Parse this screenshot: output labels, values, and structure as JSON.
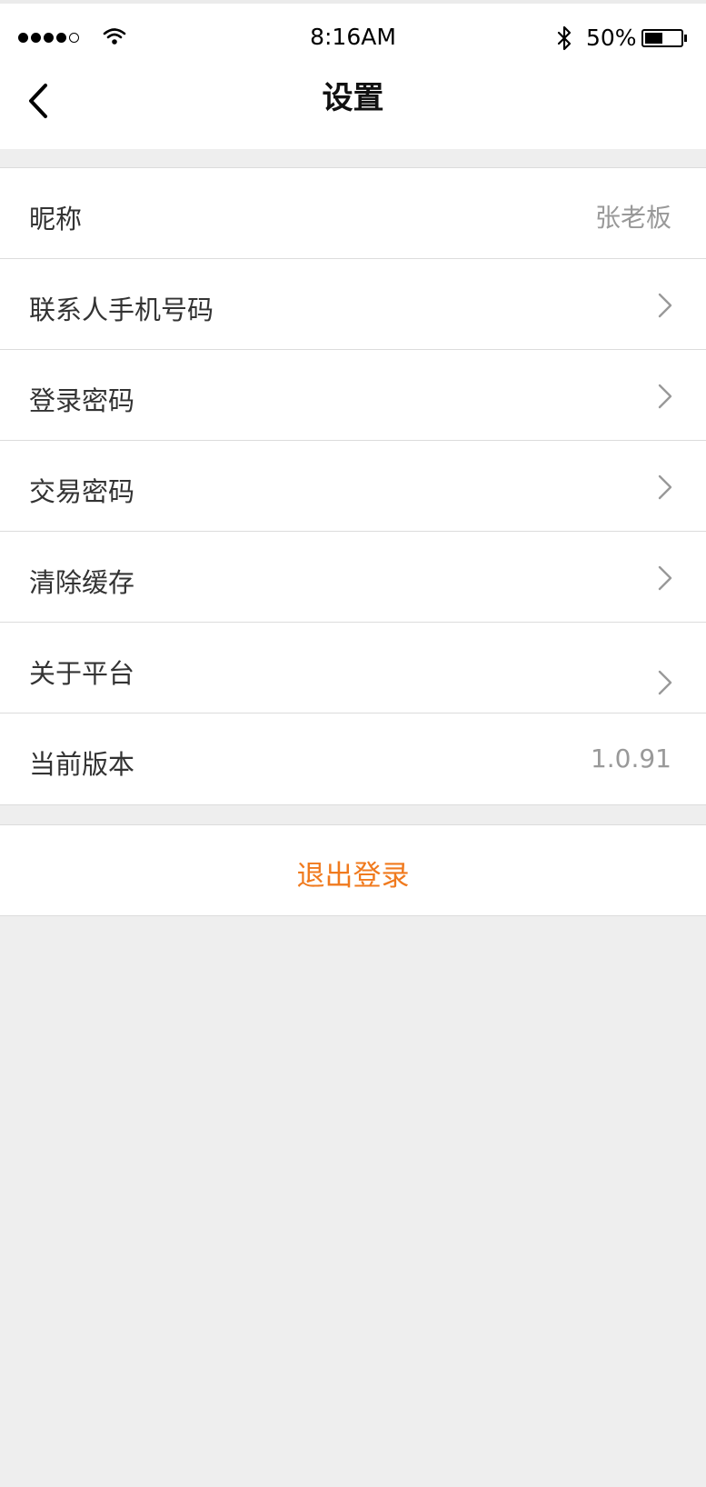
{
  "status_bar": {
    "time": "8:16AM",
    "battery_percent": "50%",
    "battery_level": 0.5,
    "signal_bars": 4,
    "signal_total": 5
  },
  "nav": {
    "title": "设置"
  },
  "settings": {
    "nickname": {
      "label": "昵称",
      "value": "张老板"
    },
    "phone": {
      "label": "联系人手机号码"
    },
    "login_password": {
      "label": "登录密码"
    },
    "trade_password": {
      "label": "交易密码"
    },
    "clear_cache": {
      "label": "清除缓存"
    },
    "about": {
      "label": "关于平台"
    },
    "version": {
      "label": "当前版本",
      "value": "1.0.91"
    }
  },
  "logout": {
    "label": "退出登录"
  },
  "colors": {
    "accent": "#f07a1e",
    "background": "#eeeeee",
    "value_text": "#999999"
  }
}
